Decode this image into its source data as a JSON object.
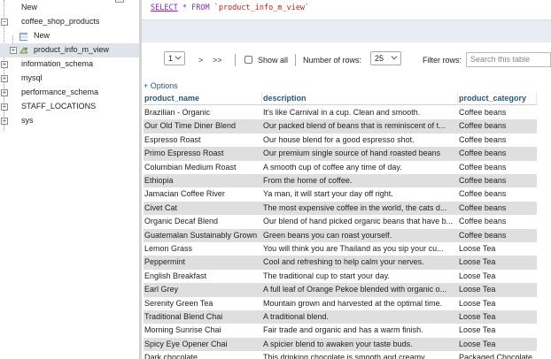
{
  "sidebar": {
    "items": [
      {
        "label": "New",
        "level": 0,
        "icon": "new-db-icon"
      },
      {
        "label": "coffee_shop_products",
        "level": 0,
        "icon": "database-icon"
      },
      {
        "label": "New",
        "level": 1,
        "icon": "new-table-icon"
      },
      {
        "label": "product_info_m_view",
        "level": 1,
        "icon": "view-icon",
        "selected": true
      },
      {
        "label": "information_schema",
        "level": 0,
        "icon": "database-icon"
      },
      {
        "label": "mysql",
        "level": 0,
        "icon": "database-icon"
      },
      {
        "label": "performance_schema",
        "level": 0,
        "icon": "database-icon"
      },
      {
        "label": "STAFF_LOCATIONS",
        "level": 0,
        "icon": "database-icon"
      },
      {
        "label": "sys",
        "level": 0,
        "icon": "database-icon"
      }
    ]
  },
  "query": {
    "select": "SELECT",
    "star": "*",
    "from": "FROM",
    "table": "`product_info_m_view`"
  },
  "controls": {
    "page": "1",
    "next": ">",
    "last": ">>",
    "show_all": "Show all",
    "rows_label": "Number of rows:",
    "rows_value": "25",
    "filter_label": "Filter rows:",
    "search_placeholder": "Search this table"
  },
  "options_link": "+ Options",
  "table": {
    "columns": [
      "product_name",
      "description",
      "product_category"
    ],
    "rows": [
      [
        "Brazilian - Organic",
        "It's like Carnival in a cup. Clean and smooth.",
        "Coffee beans"
      ],
      [
        "Our Old Time Diner Blend",
        "Our packed blend of beans that is reminiscent of t...",
        "Coffee beans"
      ],
      [
        "Espresso Roast",
        "Our house blend for a good espresso shot.",
        "Coffee beans"
      ],
      [
        "Primo Espresso Roast",
        "Our premium single source of hand roasted beans",
        "Coffee beans"
      ],
      [
        "Columbian Medium Roast",
        "A smooth cup of coffee any time of day.",
        "Coffee beans"
      ],
      [
        "Ethiopia",
        "From the home of coffee.",
        "Coffee beans"
      ],
      [
        "Jamacian Coffee River",
        "Ya man, it will start your day off right.",
        "Coffee beans"
      ],
      [
        "Civet Cat",
        "The most expensive coffee in the world, the cats d...",
        "Coffee beans"
      ],
      [
        "Organic Decaf Blend",
        "Our blend of hand picked organic beans that have b...",
        "Coffee beans"
      ],
      [
        "Guatemalan Sustainably Grown",
        "Green beans you can roast yourself.",
        "Coffee beans"
      ],
      [
        "Lemon Grass",
        "You will think you are Thailand as you sip your cu...",
        "Loose Tea"
      ],
      [
        "Peppermint",
        "Cool and refreshing to help calm your nerves.",
        "Loose Tea"
      ],
      [
        "English Breakfast",
        "The traditional cup to start your day.",
        "Loose Tea"
      ],
      [
        "Earl Grey",
        "A full leaf of Orange Pekoe blended with organic o...",
        "Loose Tea"
      ],
      [
        "Serenity Green Tea",
        "Mountain grown and harvested at the optimal time.",
        "Loose Tea"
      ],
      [
        "Traditional Blend Chai",
        "A traditional blend.",
        "Loose Tea"
      ],
      [
        "Morning Sunrise Chai",
        "Fair trade and organic and has a warm finish.",
        "Loose Tea"
      ],
      [
        "Spicy Eye Opener Chai",
        "A spicier blend to awaken your taste buds.",
        "Loose Tea"
      ],
      [
        "Dark chocolate",
        "This drinking chocolate is smooth and creamy.",
        "Packaged Chocolate"
      ]
    ]
  }
}
